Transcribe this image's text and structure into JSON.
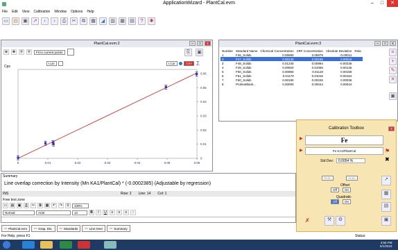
{
  "app": {
    "title": "ApplicationWizard - PlantCal.evm"
  },
  "window_controls": {
    "minimize": "–",
    "maximize": "□",
    "close": "✕"
  },
  "menu": [
    "File",
    "Edit",
    "View",
    "Calibration",
    "Window",
    "Options",
    "Help"
  ],
  "toolbar": [
    "new",
    "open",
    "save",
    "plot",
    "undo",
    "redo",
    "print",
    "cut",
    "copy",
    "paste",
    "graph",
    "table",
    "grid",
    "calc",
    "help",
    "info"
  ],
  "chart_window": {
    "title": "PlantCal.evm:2",
    "fit_label": "Fit to current points",
    "y_label": "Cps",
    "lin_label": "I.Lin",
    "cor_label": "I.Cor",
    "csv_label": "CSV",
    "chart_data": {
      "type": "scatter",
      "xlabel": "",
      "ylabel": "Cps",
      "x_ticks": [
        "0",
        "0.01",
        "0.02",
        "0.03",
        "0.04",
        "0.05",
        "0.06"
      ],
      "y_ticks": [
        "0.06",
        "0.05",
        "0.04",
        "0.03",
        "0.02",
        "0.01",
        "0"
      ],
      "xlim": [
        0,
        0.06
      ],
      "ylim": [
        0,
        0.063
      ],
      "points": [
        {
          "x": 0.0,
          "y": 0.0004
        },
        {
          "x": 0.0092,
          "y": 0.0107
        },
        {
          "x": 0.0117,
          "y": 0.0112
        },
        {
          "x": 0.0119,
          "y": 0.0102
        },
        {
          "x": 0.0496,
          "y": 0.0505
        },
        {
          "x": 0.0599,
          "y": 0.0598
        }
      ],
      "fit_line": [
        [
          0,
          0
        ],
        [
          0.06,
          0.0605
        ]
      ]
    }
  },
  "table_window": {
    "title": "PlantCal.evm:3",
    "columns": [
      "Number",
      "Standard Name",
      "Chemical Concentration",
      "XRF Concentration",
      "Absolute Deviation",
      "Rela"
    ],
    "rows": [
      [
        "1",
        "F46_Solids",
        "0.05990",
        "0.05979",
        "-0.00011",
        ""
      ],
      [
        "2",
        "F47_Solids",
        "0.00140",
        "0.00155",
        "0.00015",
        ""
      ],
      [
        "3",
        "F48_Solids",
        "0.01230",
        "0.00994",
        "-0.00236",
        ""
      ],
      [
        "4",
        "F49_Solids",
        "0.00920",
        "0.01066",
        "0.00146",
        ""
      ],
      [
        "5",
        "F50_Solids",
        "0.00960",
        "0.01119",
        "0.00159",
        ""
      ],
      [
        "6",
        "F51_Solids",
        "0.01170",
        "0.01016",
        "-0.00154",
        ""
      ],
      [
        "7",
        "F60_Solids",
        "0.00190",
        "0.00226",
        "0.00036",
        ""
      ],
      [
        "8",
        "ProlineBlank...",
        "0.00000",
        "0.00044",
        "0.00044",
        ""
      ]
    ],
    "selected_row": 1
  },
  "summary": {
    "label": "Summary",
    "text": "Line overlap correction by Intensity (Mn KA1/PlantCal) * (-0.0002385) (Adjustable by regression)",
    "ins": "INS",
    "row": "Row: 2",
    "line": "Line: 14",
    "col": "Col: 1"
  },
  "free_text": {
    "label": "Free text zone",
    "style": "Normal",
    "font": "Arial",
    "size": "12",
    "zoom": "100%"
  },
  "tabs": [
    "PlantCal.evm",
    "Grap. Dis.",
    "Standards",
    "Line Over",
    "Summary"
  ],
  "toolbox": {
    "title": "Calibration Toolbox",
    "element": "Fe",
    "line": "Fe KA1/PlantCal",
    "std_dev_label": "Std Dev:",
    "std_dev_value": "0.0054 %",
    "redo": "Redo",
    "undo": "Undo",
    "offset_label": "Offset",
    "quadratic_label": "Quadratic",
    "off": "Off",
    "on": "On"
  },
  "status": {
    "left": "For Help, press F1",
    "right": "Status:"
  },
  "tray": {
    "time": "3:56 PM",
    "date": "6/1/2015"
  },
  "colors": {
    "accent": "#3b6fd6",
    "toolbox_bg": "#f7e6b4",
    "toolbox_border": "#e0b050",
    "taskbar": "#1f3b63",
    "close": "#d33"
  }
}
